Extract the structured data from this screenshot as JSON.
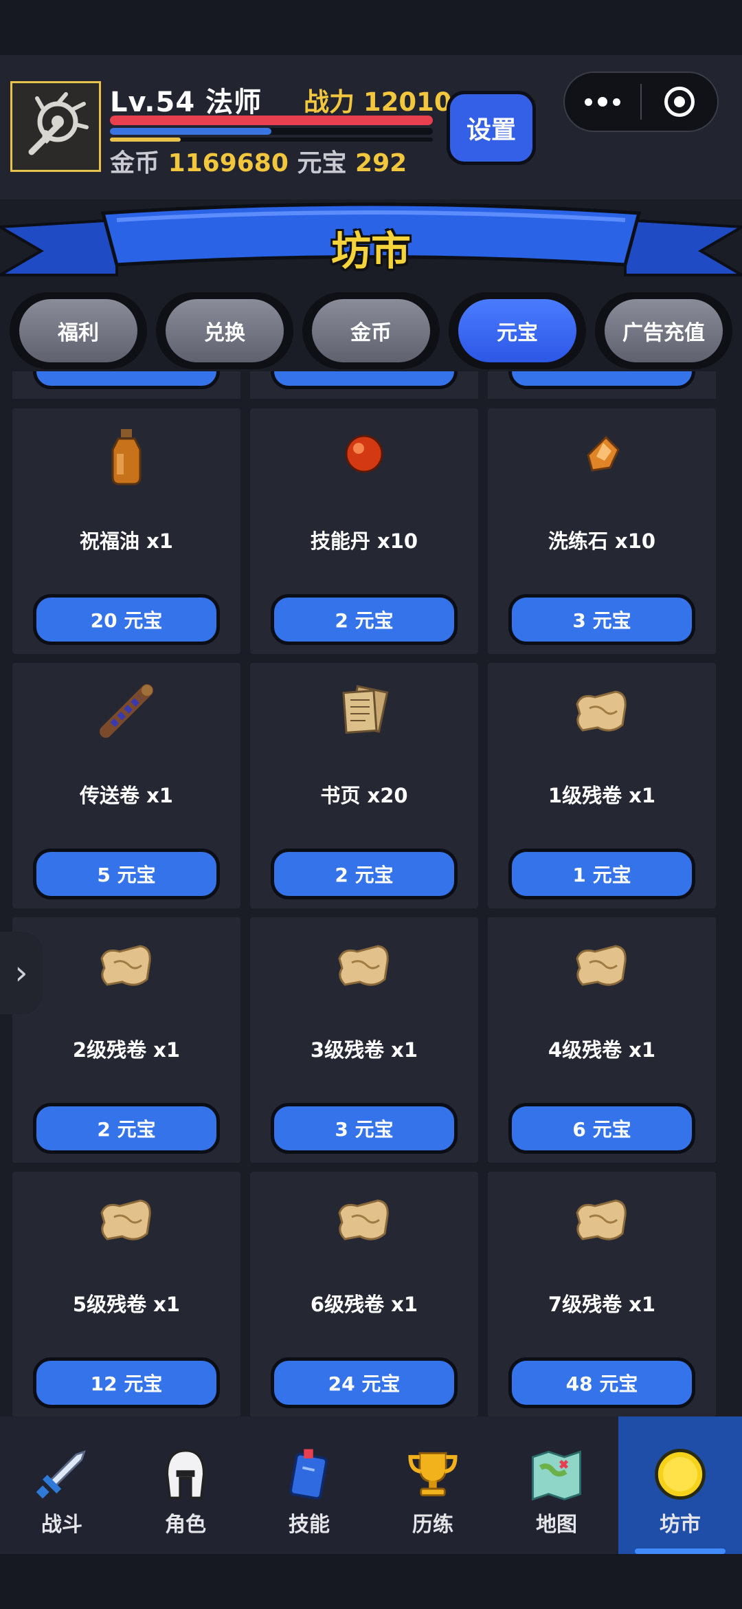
{
  "header": {
    "level_class": "Lv.54 法师",
    "power": "战力 12010",
    "hp_fraction": 1.0,
    "mp_fraction": 0.5,
    "xp_fraction": 0.22,
    "gold_label": "金币",
    "gold_value": "1169680",
    "yuanbao_label": "元宝",
    "yuanbao_value": "292",
    "settings_label": "设置"
  },
  "banner": {
    "title": "坊市"
  },
  "tabs": [
    {
      "label": "福利",
      "active": false
    },
    {
      "label": "兑换",
      "active": false
    },
    {
      "label": "金币",
      "active": false
    },
    {
      "label": "元宝",
      "active": true
    },
    {
      "label": "广告充值",
      "active": false
    }
  ],
  "items": [
    {
      "name": "祝福油 x1",
      "price": "20 元宝",
      "icon": "oil-bottle-icon"
    },
    {
      "name": "技能丹 x10",
      "price": "2 元宝",
      "icon": "red-pill-icon"
    },
    {
      "name": "洗练石 x10",
      "price": "3 元宝",
      "icon": "amber-stone-icon"
    },
    {
      "name": "传送卷 x1",
      "price": "5 元宝",
      "icon": "teleport-scroll-icon"
    },
    {
      "name": "书页 x20",
      "price": "2 元宝",
      "icon": "book-page-icon"
    },
    {
      "name": "1级残卷 x1",
      "price": "1 元宝",
      "icon": "scroll-fragment-icon"
    },
    {
      "name": "2级残卷 x1",
      "price": "2 元宝",
      "icon": "scroll-fragment-icon"
    },
    {
      "name": "3级残卷 x1",
      "price": "3 元宝",
      "icon": "scroll-fragment-icon"
    },
    {
      "name": "4级残卷 x1",
      "price": "6 元宝",
      "icon": "scroll-fragment-icon"
    },
    {
      "name": "5级残卷 x1",
      "price": "12 元宝",
      "icon": "scroll-fragment-icon"
    },
    {
      "name": "6级残卷 x1",
      "price": "24 元宝",
      "icon": "scroll-fragment-icon"
    },
    {
      "name": "7级残卷 x1",
      "price": "48 元宝",
      "icon": "scroll-fragment-icon"
    }
  ],
  "nav": [
    {
      "label": "战斗",
      "icon": "sword-icon",
      "active": false
    },
    {
      "label": "角色",
      "icon": "helmet-icon",
      "active": false
    },
    {
      "label": "技能",
      "icon": "spellbook-icon",
      "active": false
    },
    {
      "label": "历练",
      "icon": "trophy-icon",
      "active": false
    },
    {
      "label": "地图",
      "icon": "map-icon",
      "active": false
    },
    {
      "label": "坊市",
      "icon": "coin-icon",
      "active": true
    }
  ],
  "colors": {
    "background": "#1a1c26",
    "card": "#252733",
    "button": "#3473ea",
    "accent_gold": "#f2c73e",
    "hp": "#e8404f",
    "mp": "#3a74e0"
  }
}
